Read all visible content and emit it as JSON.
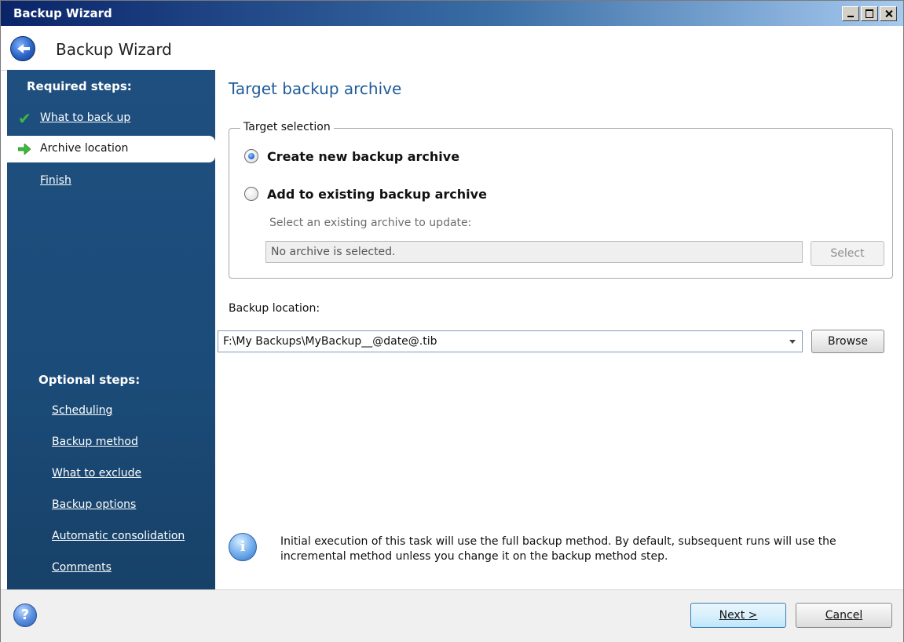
{
  "window": {
    "title": "Backup Wizard"
  },
  "header": {
    "title": "Backup Wizard"
  },
  "sidebar": {
    "required_heading": "Required steps:",
    "required_items": [
      {
        "label": "What to back up",
        "state": "done"
      },
      {
        "label": "Archive location",
        "state": "current"
      },
      {
        "label": "Finish",
        "state": "pending"
      }
    ],
    "optional_heading": "Optional steps:",
    "optional_items": [
      {
        "label": "Scheduling"
      },
      {
        "label": "Backup method"
      },
      {
        "label": "What to exclude"
      },
      {
        "label": "Backup options"
      },
      {
        "label": "Automatic consolidation"
      },
      {
        "label": "Comments"
      }
    ]
  },
  "main": {
    "title": "Target backup archive",
    "target_group_legend": "Target selection",
    "option_create_label": "Create new backup archive",
    "option_add_label": "Add to existing backup archive",
    "selected_option": "create",
    "existing_archive_prompt": "Select an existing archive to update:",
    "existing_archive_value": "No archive is selected.",
    "select_button_label": "Select",
    "backup_location_label": "Backup location:",
    "backup_location_value": "F:\\My Backups\\MyBackup__@date@.tib",
    "browse_button_label": "Browse",
    "info_text": "Initial execution of this task will use the full backup method. By default, subsequent runs will use the incremental method unless you change it on the backup method step."
  },
  "footer": {
    "next_label": "Next >",
    "cancel_label": "Cancel"
  },
  "colors": {
    "sidebar_bg": "#1e4f7f",
    "title_accent": "#1f5c99",
    "check_green": "#3fb83f"
  },
  "icons": {
    "back": "back-arrow-icon",
    "done": "checkmark-icon",
    "current": "green-arrow-icon",
    "info": "info-icon",
    "help": "help-icon"
  }
}
